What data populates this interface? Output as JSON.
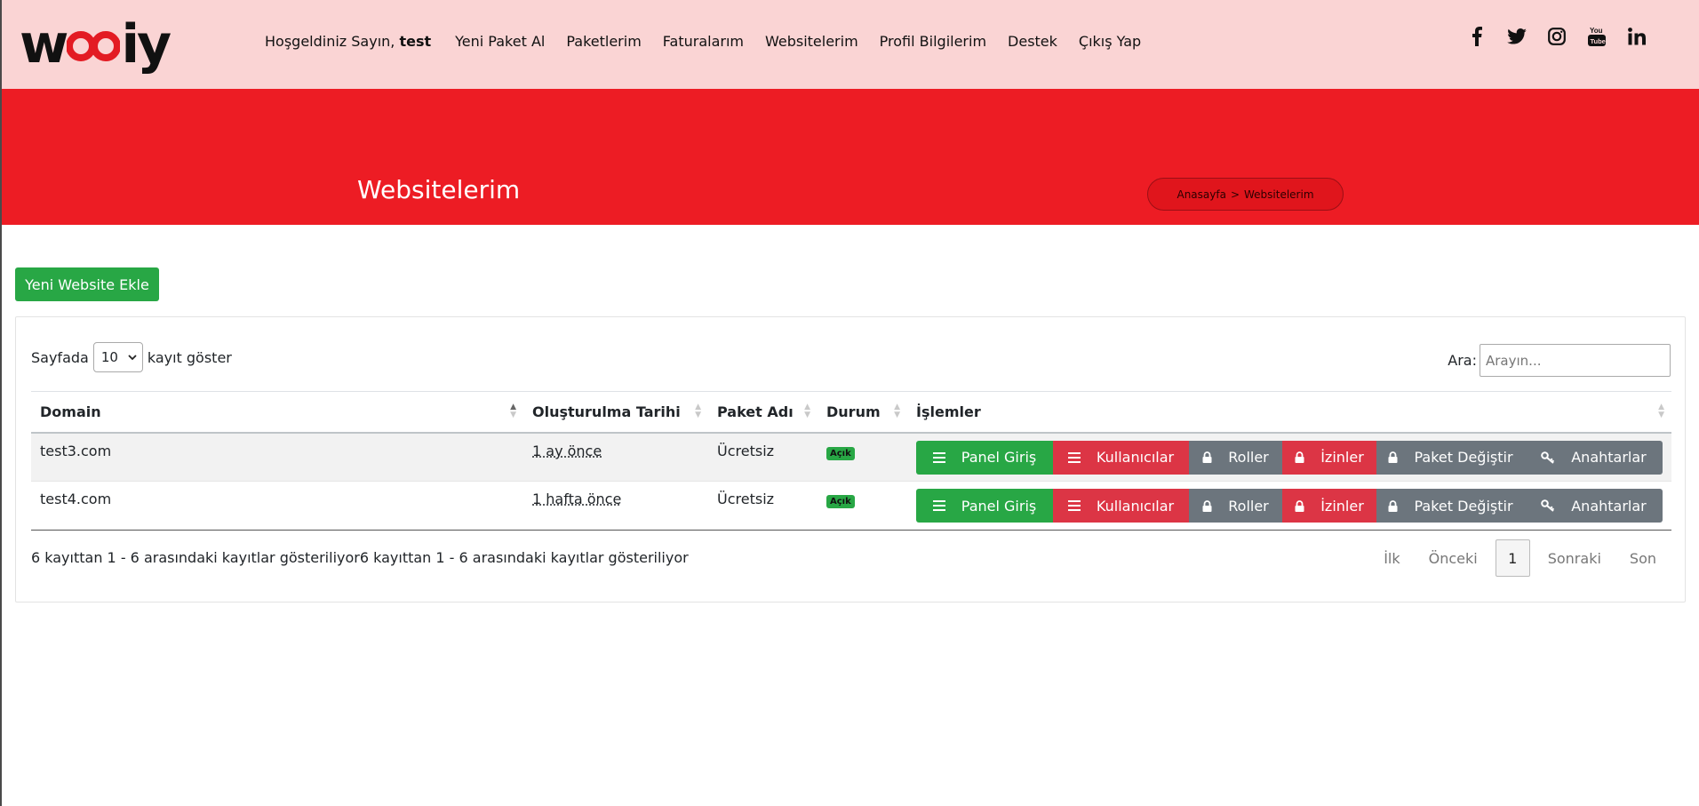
{
  "brand": {
    "logo_text_left": "w",
    "logo_text_right": "iy",
    "accent": "#ed1c24",
    "header_bg": "#fad4d4"
  },
  "header": {
    "welcome_prefix": "Hoşgeldiniz Sayın,",
    "user": "test",
    "nav": [
      "Yeni Paket Al",
      "Paketlerim",
      "Faturalarım",
      "Websitelerim",
      "Profil Bilgilerim",
      "Destek",
      "Çıkış Yap"
    ],
    "social": [
      "facebook-icon",
      "twitter-icon",
      "instagram-icon",
      "youtube-icon",
      "linkedin-icon"
    ]
  },
  "hero": {
    "title": "Websitelerim",
    "breadcrumb": {
      "home": "Anasayfa",
      "sep": ">",
      "current": "Websitelerim"
    }
  },
  "actions": {
    "add_label": "Yeni Website Ekle"
  },
  "table_controls": {
    "length_prefix": "Sayfada",
    "length_value": "10",
    "length_suffix": "kayıt göster",
    "search_label": "Ara:",
    "search_placeholder": "Arayın..."
  },
  "table": {
    "columns": [
      "Domain",
      "Oluşturulma Tarihi",
      "Paket Adı",
      "Durum",
      "İşlemler"
    ],
    "rows": [
      {
        "domain": "test3.com",
        "created": "1 ay önce",
        "package": "Ücretsiz",
        "status": "Açık"
      },
      {
        "domain": "test4.com",
        "created": "1 hafta önce",
        "package": "Ücretsiz",
        "status": "Açık"
      }
    ],
    "row_actions": [
      "Panel Giriş",
      "Kullanıcılar",
      "Roller",
      "İzinler",
      "Paket Değiştir",
      "Anahtarlar"
    ]
  },
  "footer": {
    "info": "6 kayıttan 1 - 6 arasındaki kayıtlar gösteriliyor6 kayıttan 1 - 6 arasındaki kayıtlar gösteriliyor",
    "pager": {
      "first": "İlk",
      "prev": "Önceki",
      "current": "1",
      "next": "Sonraki",
      "last": "Son"
    }
  }
}
